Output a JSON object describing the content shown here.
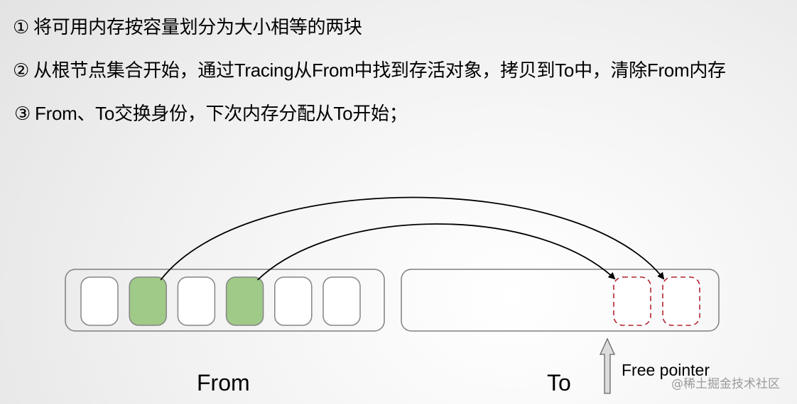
{
  "steps": [
    {
      "num": "①",
      "text": "将可用内存按容量划分为大小相等的两块"
    },
    {
      "num": "②",
      "text": "从根节点集合开始，通过Tracing从From中找到存活对象，拷贝到To中，清除From内存"
    },
    {
      "num": "③",
      "text": "From、To交换身份，下次内存分配从To开始；"
    }
  ],
  "diagram": {
    "from_space": {
      "label": "From",
      "blocks": [
        {
          "state": "free"
        },
        {
          "state": "live"
        },
        {
          "state": "free"
        },
        {
          "state": "live"
        },
        {
          "state": "free"
        },
        {
          "state": "free"
        }
      ]
    },
    "to_space": {
      "label": "To",
      "copied_blocks": 2
    },
    "copies": [
      {
        "from_block": 1,
        "to_slot": 1
      },
      {
        "from_block": 3,
        "to_slot": 0
      }
    ],
    "free_pointer_label": "Free pointer",
    "colors": {
      "live": "#a0ca88",
      "free": "#ffffff",
      "block_border": "#858585",
      "container_border": "#7f7f7f",
      "copied_border": "#b22330",
      "arrow": "#000000",
      "pointer_fill": "#dcdcdc"
    }
  },
  "watermark": "@稀土掘金技术社区"
}
